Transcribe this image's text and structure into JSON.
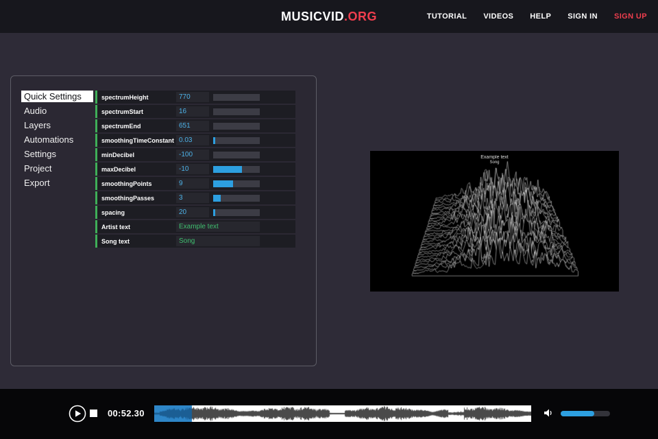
{
  "nav": {
    "brand_left": "MUSICVID",
    "brand_right": ".ORG",
    "items": [
      {
        "label": "TUTORIAL"
      },
      {
        "label": "VIDEOS"
      },
      {
        "label": "HELP"
      },
      {
        "label": "SIGN IN"
      },
      {
        "label": "SIGN UP",
        "accent": true
      }
    ]
  },
  "editor": {
    "sidebar": {
      "items": [
        "Quick Settings",
        "Audio",
        "Layers",
        "Automations",
        "Settings",
        "Project",
        "Export"
      ],
      "selected": "Quick Settings"
    },
    "fields": [
      {
        "label": "spectrumHeight",
        "value": "770",
        "type": "number",
        "slider": 0
      },
      {
        "label": "spectrumStart",
        "value": "16",
        "type": "number",
        "slider": 0
      },
      {
        "label": "spectrumEnd",
        "value": "651",
        "type": "number",
        "slider": 0
      },
      {
        "label": "smoothingTimeConstant",
        "value": "0.03",
        "type": "number",
        "slider": 0.05
      },
      {
        "label": "minDecibel",
        "value": "-100",
        "type": "number",
        "slider": 0
      },
      {
        "label": "maxDecibel",
        "value": "-10",
        "type": "number",
        "slider": 0.62
      },
      {
        "label": "smoothingPoints",
        "value": "9",
        "type": "number",
        "slider": 0.42
      },
      {
        "label": "smoothingPasses",
        "value": "3",
        "type": "number",
        "slider": 0.16
      },
      {
        "label": "spacing",
        "value": "20",
        "type": "number",
        "slider": 0.07
      }
    ],
    "text_fields": [
      {
        "label": "Artist text",
        "value": "Example text",
        "type": "text"
      },
      {
        "label": "Song text",
        "value": "Song",
        "type": "text"
      }
    ]
  },
  "preview": {
    "title_line1": "Example text",
    "title_line2": "Song"
  },
  "player": {
    "time": "00:52.30",
    "progress": 0.1,
    "volume": 0.68
  },
  "colors": {
    "accent_red": "#ef3e4e",
    "accent_blue": "#2d9fe0",
    "accent_green": "#3fae58",
    "value_text_blue": "#4db2e8",
    "value_text_green": "#3fbf6f"
  }
}
